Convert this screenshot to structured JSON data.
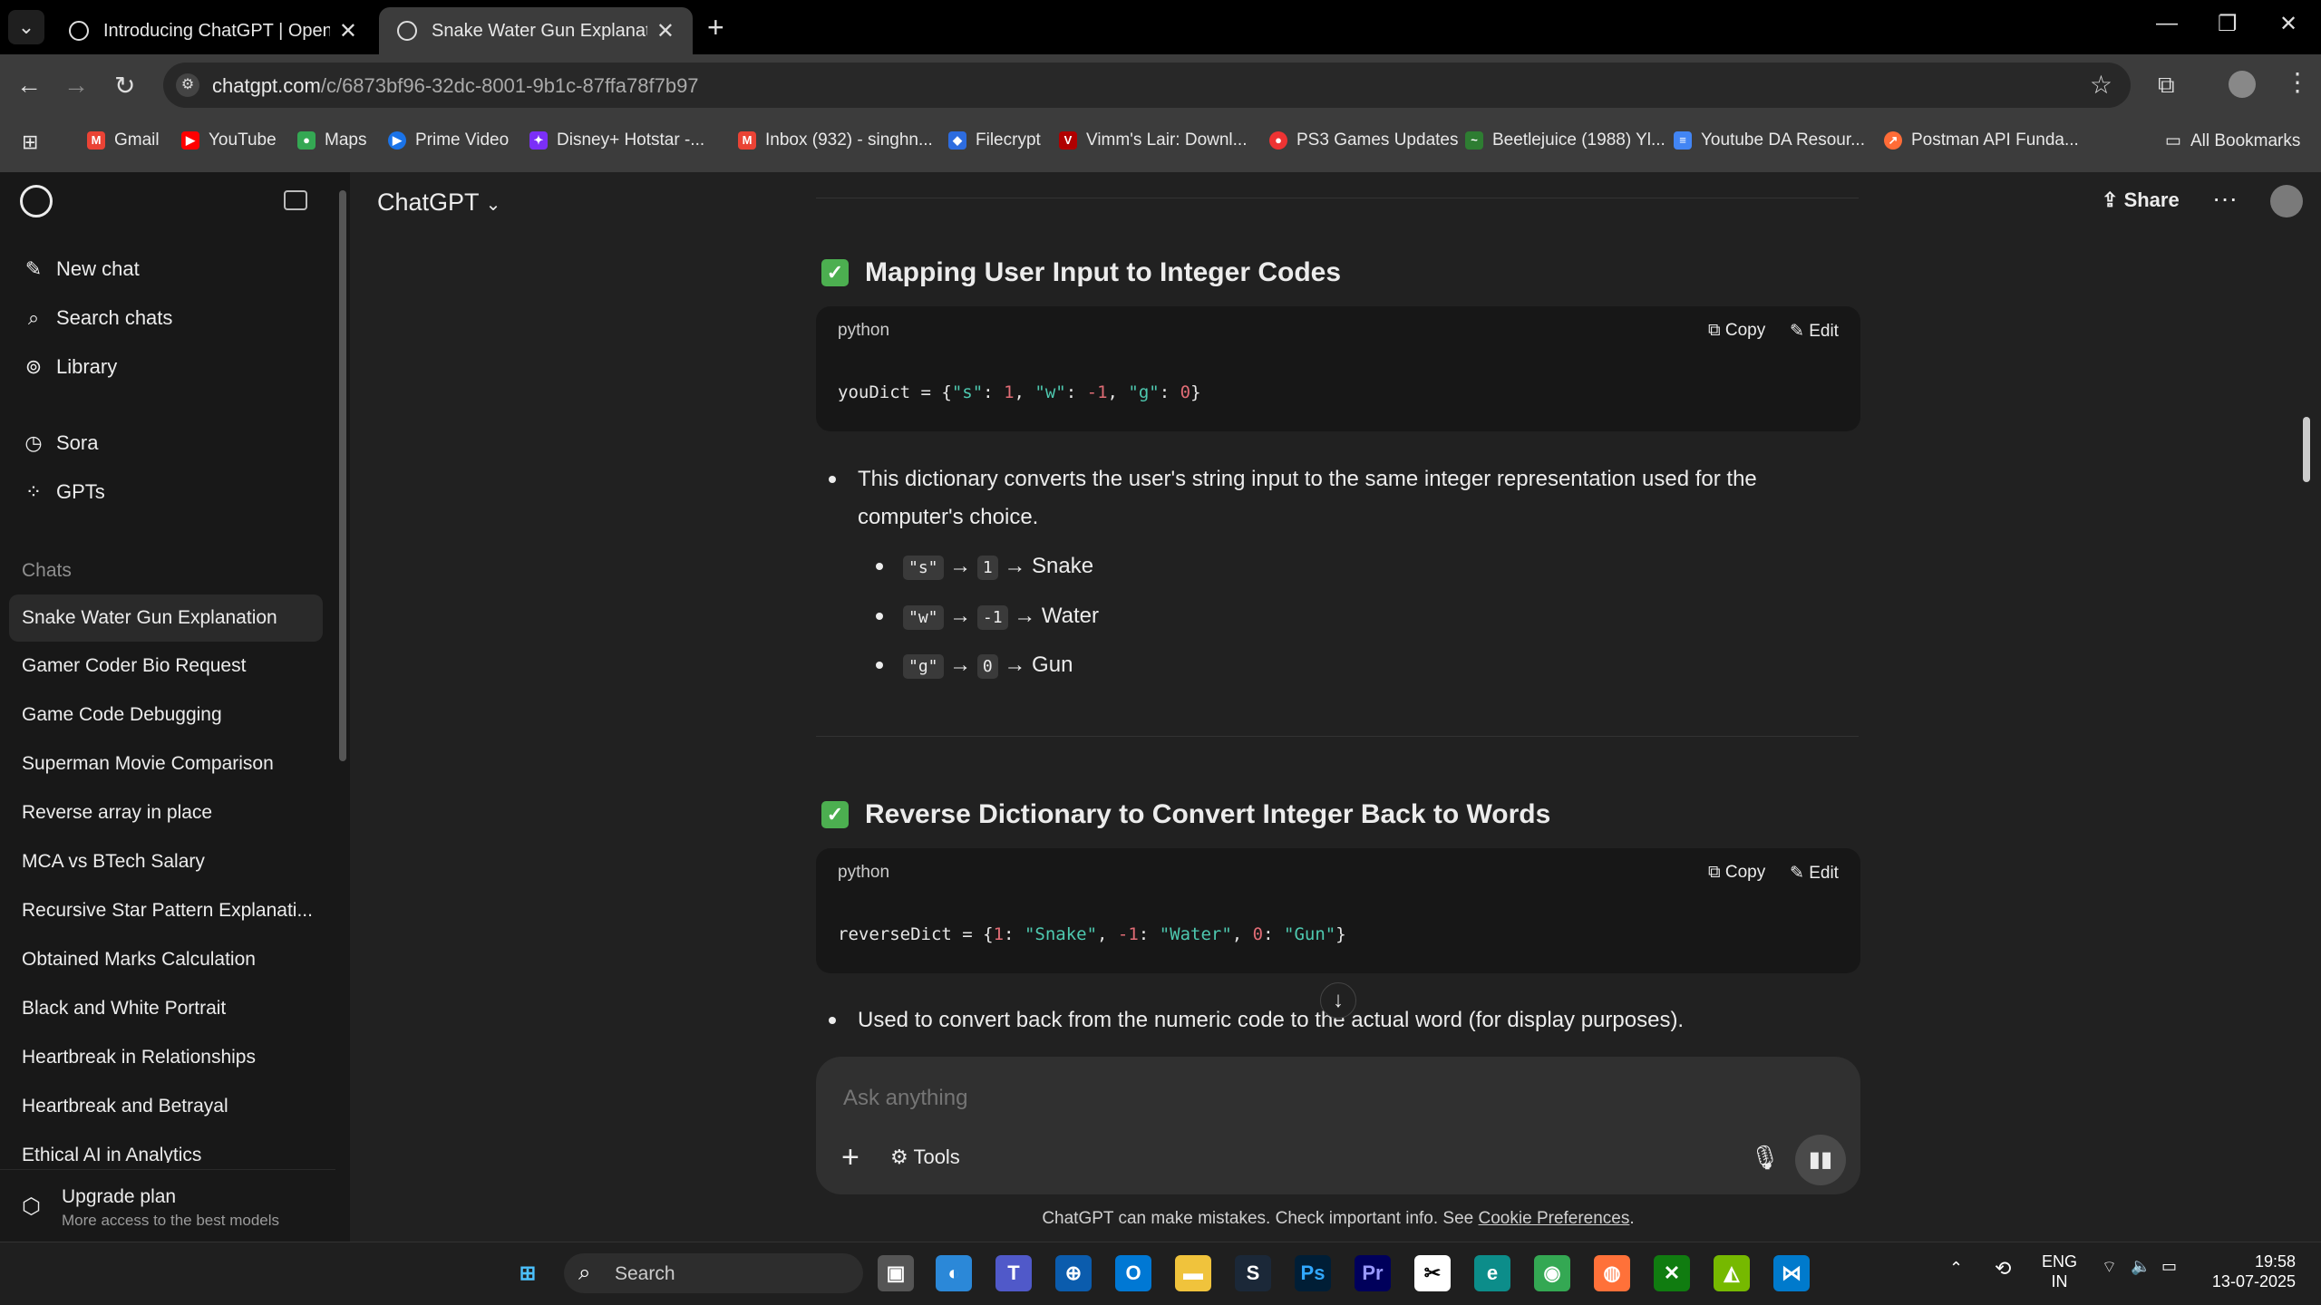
{
  "browser": {
    "tabs": [
      {
        "label": "Introducing ChatGPT | OpenAI"
      },
      {
        "label": "Snake Water Gun Explanation"
      }
    ],
    "url_host": "chatgpt.com",
    "url_path": "/c/6873bf96-32dc-8001-9b1c-87ffa78f7b97",
    "bookmarks": [
      "Gmail",
      "YouTube",
      "Maps",
      "Prime Video",
      "Disney+ Hotstar -...",
      "Inbox (932) - singhn...",
      "Filecrypt",
      "Vimm's Lair: Downl...",
      "PS3 Games Updates",
      "Beetlejuice (1988) Yl...",
      "Youtube DA Resour...",
      "Postman API Funda..."
    ],
    "all_bookmarks": "All Bookmarks"
  },
  "sidebar": {
    "new_chat": "New chat",
    "search_chats": "Search chats",
    "library": "Library",
    "sora": "Sora",
    "gpts": "GPTs",
    "chats_heading": "Chats",
    "chats": [
      "Snake Water Gun Explanation",
      "Gamer Coder Bio Request",
      "Game Code Debugging",
      "Superman Movie Comparison",
      "Reverse array in place",
      "MCA vs BTech Salary",
      "Recursive Star Pattern Explanati...",
      "Obtained Marks Calculation",
      "Black and White Portrait",
      "Heartbreak in Relationships",
      "Heartbreak and Betrayal",
      "Ethical AI in Analytics"
    ],
    "upgrade_title": "Upgrade plan",
    "upgrade_sub": "More access to the best models"
  },
  "header": {
    "model": "ChatGPT",
    "share": "Share"
  },
  "content": {
    "section1_title": "Mapping User Input to Integer Codes",
    "section2_title": "Reverse Dictionary to Convert Integer Back to Words",
    "code_lang": "python",
    "copy_label": "Copy",
    "edit_label": "Edit",
    "para1": "This dictionary converts the user's string input to the same integer representation used for the",
    "para1b": "computer's choice.",
    "map_items": [
      {
        "key": "\"s\"",
        "code": "1",
        "word": "Snake"
      },
      {
        "key": "\"w\"",
        "code": "-1",
        "word": "Water"
      },
      {
        "key": "\"g\"",
        "code": "0",
        "word": "Gun"
      }
    ],
    "para2": "Used to convert back from the numeric code to the actual word (for display purposes)."
  },
  "composer": {
    "placeholder": "Ask anything",
    "tools": "Tools"
  },
  "disclaimer": {
    "text": "ChatGPT can make mistakes. Check important info. See",
    "link": "Cookie Preferences"
  },
  "taskbar": {
    "search": "Search",
    "lang1": "ENG",
    "lang2": "IN",
    "time": "19:58",
    "date": "13-07-2025"
  }
}
